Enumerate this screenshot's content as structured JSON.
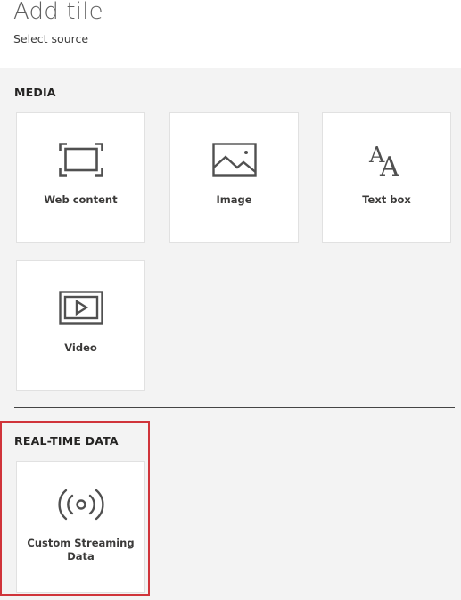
{
  "header": {
    "title": "Add tile",
    "subtitle": "Select source"
  },
  "sections": {
    "media": {
      "heading": "MEDIA",
      "tiles": [
        {
          "label": "Web content",
          "icon": "web-content-icon"
        },
        {
          "label": "Image",
          "icon": "image-icon"
        },
        {
          "label": "Text box",
          "icon": "text-box-icon"
        },
        {
          "label": "Video",
          "icon": "video-icon"
        }
      ]
    },
    "realtime": {
      "heading": "REAL-TIME DATA",
      "tiles": [
        {
          "label_line1": "Custom Streaming",
          "label_line2": "Data",
          "icon": "streaming-icon"
        }
      ]
    }
  },
  "colors": {
    "panel_bg": "#f3f3f3",
    "tile_bg": "#ffffff",
    "icon": "#505050",
    "highlight_border": "#d0343a"
  }
}
